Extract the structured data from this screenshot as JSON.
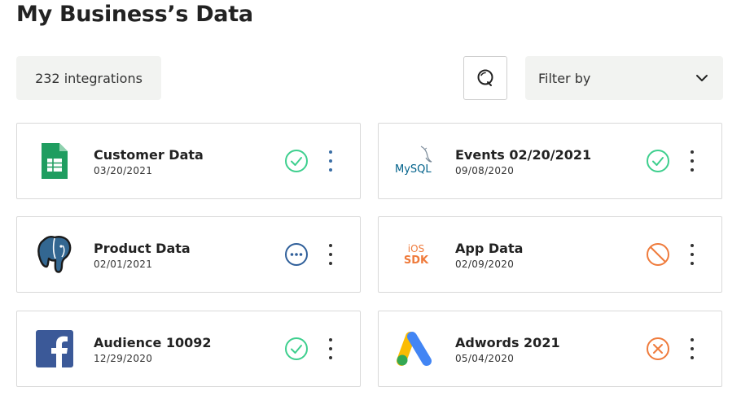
{
  "page": {
    "title": "My Business’s Data"
  },
  "toolbar": {
    "integration_count": "232 integrations",
    "search_icon": "search-icon",
    "filter_label": "Filter by",
    "filter_icon": "chevron-down-icon"
  },
  "colors": {
    "success": "#3ecf8e",
    "pending": "#2f5f9a",
    "error": "#ef7b3c",
    "panel_bg": "#f2f3f1"
  },
  "integrations": [
    {
      "name": "Customer Data",
      "date": "03/20/2021",
      "logo": "google-sheets-icon",
      "status": "success"
    },
    {
      "name": "Events 02/20/2021",
      "date": "09/08/2020",
      "logo": "mysql-logo",
      "logo_text": "MySQL",
      "status": "success"
    },
    {
      "name": "Product Data",
      "date": "02/01/2021",
      "logo": "postgresql-elephant-icon",
      "status": "pending"
    },
    {
      "name": "App Data",
      "date": "02/09/2020",
      "logo": "ios-sdk-logo",
      "logo_text_top": "iOS",
      "logo_text_bottom": "SDK",
      "status": "blocked"
    },
    {
      "name": "Audience 10092",
      "date": "12/29/2020",
      "logo": "facebook-icon",
      "status": "success"
    },
    {
      "name": "Adwords 2021",
      "date": "05/04/2020",
      "logo": "google-ads-icon",
      "status": "error"
    }
  ]
}
